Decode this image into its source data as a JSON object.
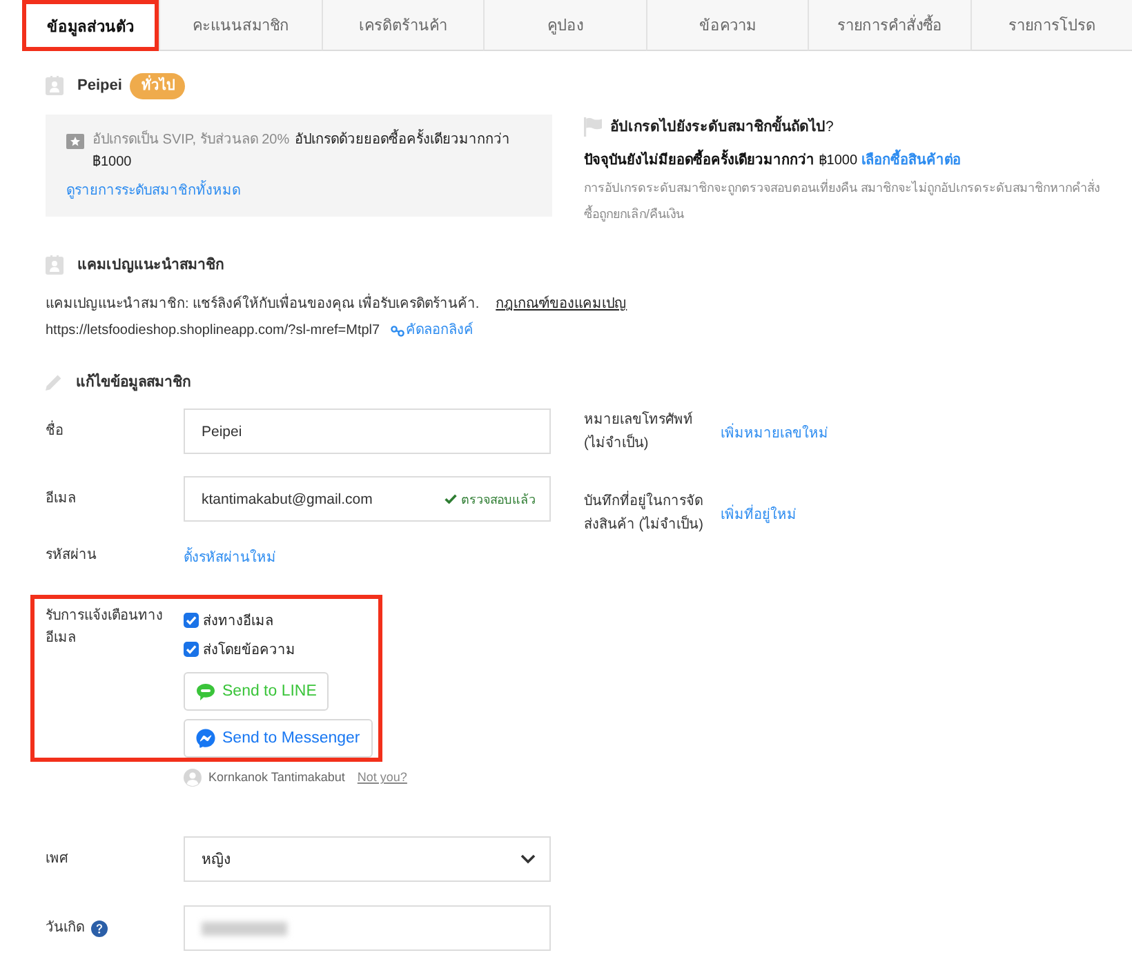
{
  "tabs": [
    {
      "label": "ข้อมูลส่วนตัว",
      "selected": true,
      "highlighted": true
    },
    {
      "label": "คะแนนสมาชิก",
      "selected": false,
      "highlighted": false
    },
    {
      "label": "เครดิตร้านค้า",
      "selected": false,
      "highlighted": false
    },
    {
      "label": "คูปอง",
      "selected": false,
      "highlighted": false
    },
    {
      "label": "ข้อความ",
      "selected": false,
      "highlighted": false
    },
    {
      "label": "รายการคำสั่งซื้อ",
      "selected": false,
      "highlighted": false
    },
    {
      "label": "รายการโปรด",
      "selected": false,
      "highlighted": false
    }
  ],
  "member": {
    "name": "Peipei",
    "tier_badge": "ทั่วไป"
  },
  "upgrade_box": {
    "perk": "อัปเกรดเป็น SVIP, รับส่วนลด 20%",
    "requirement": "อัปเกรดด้วยยอดซื้อครั้งเดียวมากกว่า ฿1000",
    "link": "ดูรายการระดับสมาชิกทั้งหมด"
  },
  "next_tier": {
    "title": "**อัปเกรดไปยังระดับสมาชิกขั้นถัดไป**?",
    "status": "**ปัจจุบันยังไม่มียอดซื้อครั้งเดียวมากกว่า** ฿1000",
    "link": "เลือกซื้อสินค้าต่อ",
    "note": "การอัปเกรดระดับสมาชิกจะถูกตรวจสอบตอนเที่ยงคืน สมาชิกจะไม่ถูกอัปเกรดระดับสมาชิกหากคำสั่งซื้อถูกยกเลิก/คืนเงิน"
  },
  "referral": {
    "title": "แคมเปญแนะนำสมาชิก",
    "description": "แคมเปญแนะนำสมาชิก: แชร์ลิงค์ให้กับเพื่อนของคุณ เพื่อรับเครดิตร้านค้า.",
    "rules_link": "กฎเกณฑ์ของแคมเปญ",
    "url": "https://letsfoodieshop.shoplineapp.com/?sl-mref=Mtpl7",
    "copy_link": "คัดลอกลิงค์"
  },
  "edit_profile": {
    "title": "แก้ไขข้อมูลสมาชิก",
    "fields": [
      {
        "kind": "input",
        "label": "ชื่อ",
        "value": "Peipei"
      },
      {
        "kind": "input",
        "label": "อีเมล",
        "value": "ktantimakabut@gmail.com",
        "verified": "ตรวจสอบแล้ว"
      },
      {
        "kind": "link",
        "label": "รหัสผ่าน",
        "link": "ตั้งรหัสผ่านใหม่"
      }
    ],
    "notifications": {
      "label": "รับการแจ้งเตือนทางอีเมล",
      "highlighted": true,
      "options": [
        {
          "label": "ส่งทางอีเมล",
          "checked": true
        },
        {
          "label": "ส่งโดยข้อความ",
          "checked": true
        }
      ],
      "buttons": [
        {
          "kind": "line",
          "label": "Send to LINE"
        },
        {
          "kind": "messenger",
          "label": "Send to Messenger"
        }
      ],
      "account": {
        "name": "Kornkanok Tantimakabut",
        "link": "Not you?"
      }
    },
    "more_fields": [
      {
        "kind": "select",
        "label": "เพศ",
        "value": "หญิง"
      },
      {
        "kind": "date",
        "label": "วันเกิด",
        "help": true,
        "redacted": true
      }
    ],
    "optional_fields": [
      {
        "label": "หมายเลขโทรศัพท์ (ไม่จำเป็น)",
        "link": "เพิ่มหมายเลขใหม่"
      },
      {
        "label": "บันทึกที่อยู่ในการจัดส่งสินค้า (ไม่จำเป็น)",
        "link": "เพิ่มที่อยู่ใหม่"
      }
    ]
  }
}
